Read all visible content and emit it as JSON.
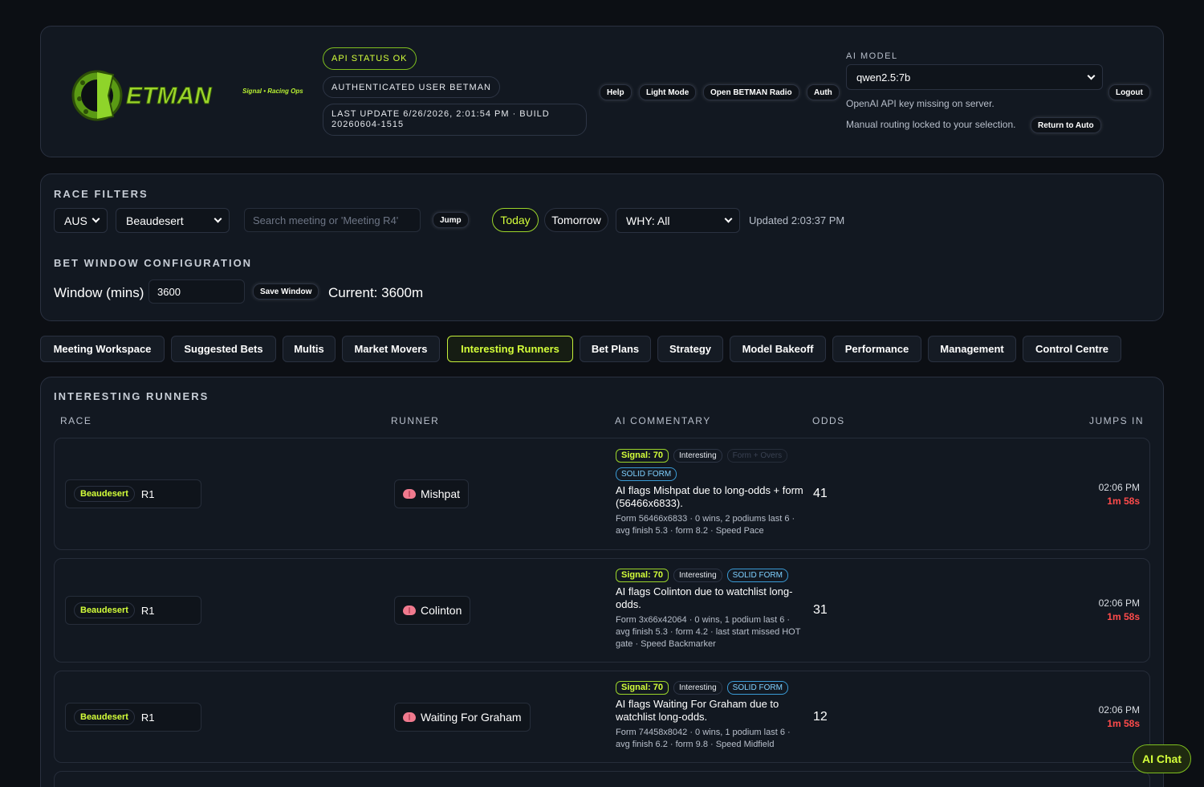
{
  "header": {
    "brand": "ETMAN",
    "tagline": "Signal • Racing Ops",
    "api_status": "API STATUS OK",
    "auth_user": "AUTHENTICATED USER BETMAN",
    "last_update": "LAST UPDATE 6/26/2026, 2:01:54 PM · BUILD 20260604-1515",
    "buttons": {
      "help": "Help",
      "light_mode": "Light Mode",
      "radio": "Open BETMAN Radio",
      "auth": "Auth",
      "logout": "Logout"
    },
    "ai_model_label": "AI MODEL",
    "ai_model_value": "qwen2.5:7b",
    "api_key_note": "OpenAI API key missing on server.",
    "routing_note": "Manual routing locked to your selection.",
    "return_auto": "Return to Auto"
  },
  "filters": {
    "title": "RACE FILTERS",
    "country": "AUS",
    "meeting": "Beaudesert",
    "search_placeholder": "Search meeting or 'Meeting R4'",
    "jump": "Jump",
    "today": "Today",
    "tomorrow": "Tomorrow",
    "why": "WHY: All",
    "updated": "Updated 2:03:37 PM"
  },
  "bet_window": {
    "title": "BET WINDOW CONFIGURATION",
    "label": "Window (mins)",
    "value": "3600",
    "save": "Save Window",
    "current": "Current: 3600m"
  },
  "tabs": [
    "Meeting Workspace",
    "Suggested Bets",
    "Multis",
    "Market Movers",
    "Interesting Runners",
    "Bet Plans",
    "Strategy",
    "Model Bakeoff",
    "Performance",
    "Management",
    "Control Centre"
  ],
  "runners": {
    "title": "INTERESTING RUNNERS",
    "columns": {
      "race": "RACE",
      "runner": "RUNNER",
      "commentary": "AI COMMENTARY",
      "odds": "ODDS",
      "jumps": "JUMPS IN"
    },
    "rows": [
      {
        "track": "Beaudesert",
        "race": "R1",
        "runner": "Mishpat",
        "signal": "Signal: 70",
        "tag": "Interesting",
        "extra": "Form + Overs",
        "form_tag": "SOLID FORM",
        "commentary": "AI flags Mishpat due to long-odds + form (56466x6833).",
        "detail": "Form 56466x6833 · 0 wins, 2 podiums last 6 · avg finish 5.3 · form 8.2 · Speed Pace",
        "odds": "41",
        "jump_time": "02:06 PM",
        "countdown": "1m 58s"
      },
      {
        "track": "Beaudesert",
        "race": "R1",
        "runner": "Colinton",
        "signal": "Signal: 70",
        "tag": "Interesting",
        "form_tag": "SOLID FORM",
        "commentary": "AI flags Colinton due to watchlist long-odds.",
        "detail": "Form 3x66x42064 · 0 wins, 1 podium last 6 · avg finish 5.3 · form 4.2 · last start missed HOT gate · Speed Backmarker",
        "odds": "31",
        "jump_time": "02:06 PM",
        "countdown": "1m 58s"
      },
      {
        "track": "Beaudesert",
        "race": "R1",
        "runner": "Waiting For Graham",
        "signal": "Signal: 70",
        "tag": "Interesting",
        "form_tag": "SOLID FORM",
        "commentary": "AI flags Waiting For Graham due to watchlist long-odds.",
        "detail": "Form 74458x8042 · 0 wins, 1 podium last 6 · avg finish 6.2 · form 9.8 · Speed Midfield",
        "odds": "12",
        "jump_time": "02:06 PM",
        "countdown": "1m 58s"
      }
    ]
  },
  "ai_chat": "AI Chat"
}
